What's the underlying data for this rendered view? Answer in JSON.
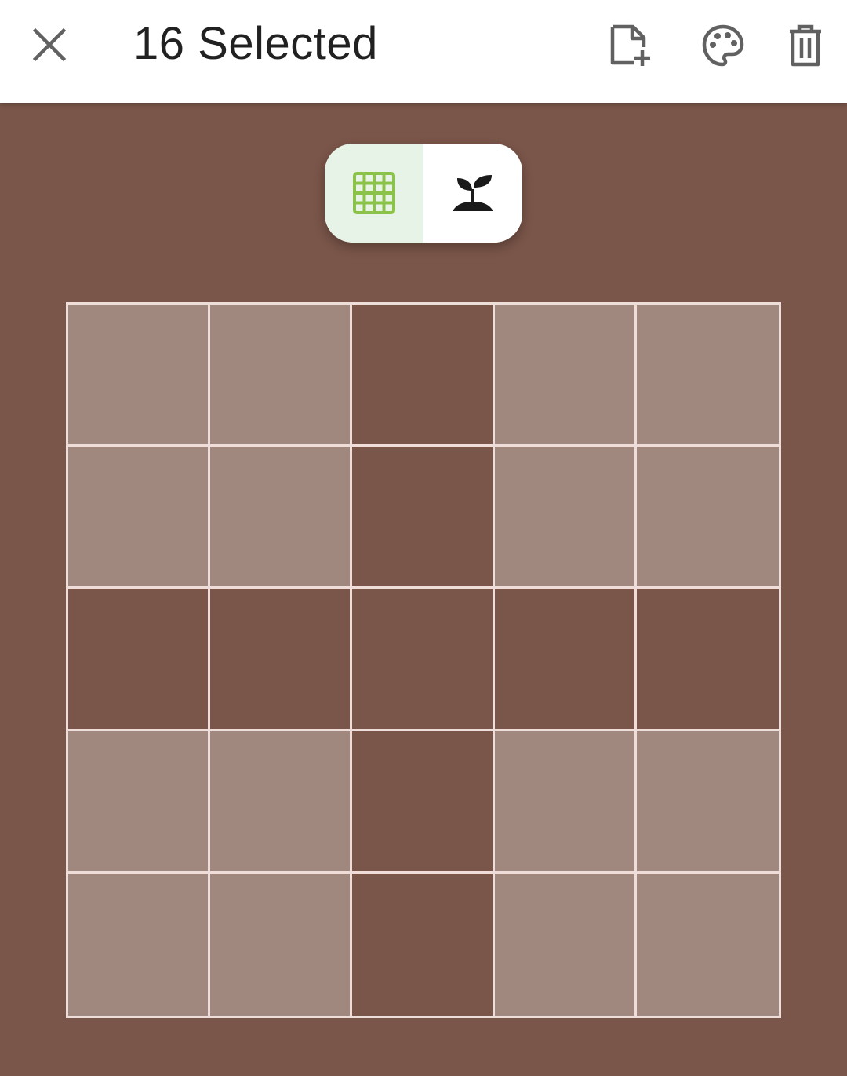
{
  "header": {
    "selection_title": "16 Selected"
  },
  "icons": {
    "close": "close-icon",
    "add_file": "note-add-icon",
    "palette": "palette-icon",
    "delete": "trash-icon",
    "grid": "grid-icon",
    "plant": "sprout-icon"
  },
  "colors": {
    "background": "#7a5549",
    "selected_cell": "#a1887e",
    "grid_line": "#eeddd9",
    "toggle_active_bg": "#e8f3e7",
    "toggle_active_icon": "#8bc34a"
  },
  "view_toggle": {
    "active": "grid"
  },
  "grid": {
    "rows": 5,
    "cols": 5,
    "selected_count": 16,
    "cells": [
      [
        true,
        true,
        false,
        true,
        true
      ],
      [
        true,
        true,
        false,
        true,
        true
      ],
      [
        false,
        false,
        false,
        false,
        false
      ],
      [
        true,
        true,
        false,
        true,
        true
      ],
      [
        true,
        true,
        false,
        true,
        true
      ]
    ]
  }
}
